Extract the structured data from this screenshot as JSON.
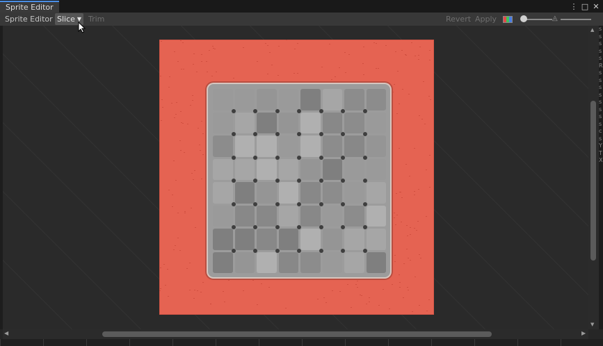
{
  "window": {
    "tab_title": "Sprite Editor"
  },
  "window_controls": [
    {
      "name": "more-options-icon",
      "glyph": "⋮"
    },
    {
      "name": "maximize-icon",
      "glyph": "□"
    },
    {
      "name": "close-icon",
      "glyph": "✕"
    }
  ],
  "toolbar": {
    "mode_dropdown": "Sprite Editor",
    "slice_dropdown": "Slice",
    "trim_button": "Trim",
    "revert_button": "Revert",
    "apply_button": "Apply"
  },
  "right_strip_chars": "sssssRsssssssscsYTX"
}
